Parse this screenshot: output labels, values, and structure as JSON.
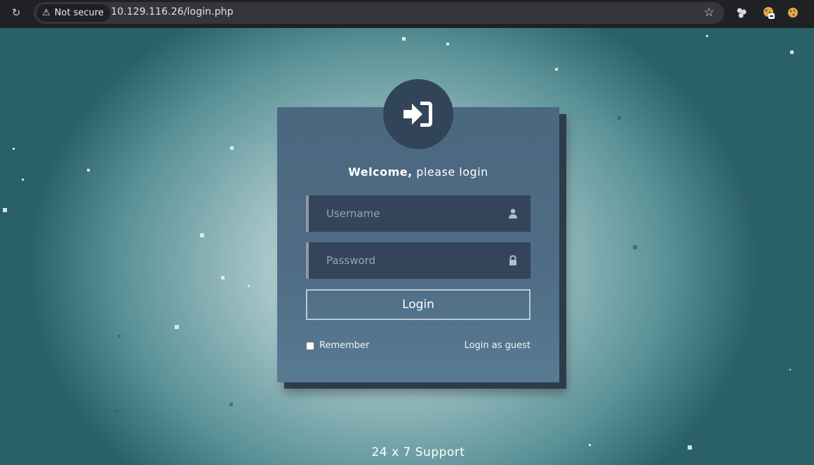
{
  "browser": {
    "security_label": "Not secure",
    "url": "10.129.116.26/login.php",
    "icons": [
      "reload-icon",
      "warning-icon",
      "star-icon",
      "extension-icon",
      "cookie-extension-icon",
      "cookie-icon"
    ]
  },
  "login_card": {
    "welcome_bold": "Welcome,",
    "welcome_rest": " please login",
    "username_placeholder": "Username",
    "password_placeholder": "Password",
    "login_button": "Login",
    "remember_label": "Remember",
    "remember_checked": false,
    "guest_link": "Login as guest"
  },
  "footer": {
    "support_text": "24 x 7 Support"
  },
  "colors": {
    "card": "#4c6780",
    "badge": "#324558",
    "field": "#34445a",
    "chrome": "#202124"
  }
}
